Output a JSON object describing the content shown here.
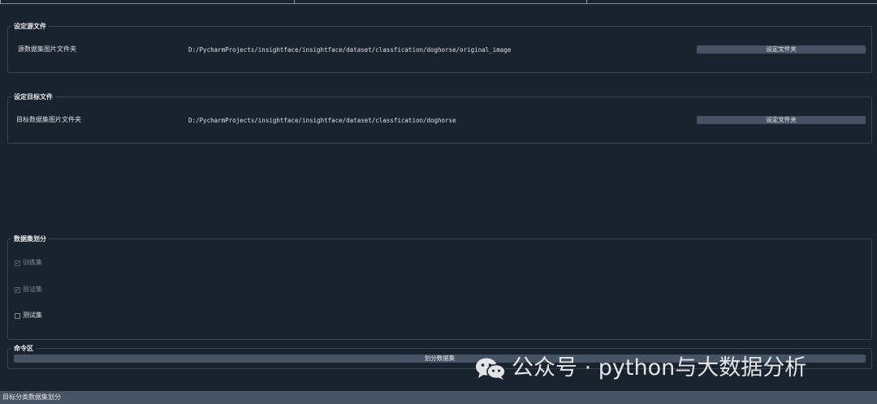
{
  "source_group": {
    "title": "设定源文件",
    "label": "源数据集图片文件夹",
    "path": "D:/PycharmProjects/insightface/insightface/dataset/classfication/doghorse/original_image",
    "button": "设定文件夹"
  },
  "target_group": {
    "title": "设定目标文件",
    "label": "目标数据集图片文件夹",
    "path": "D:/PycharmProjects/insightface/insightface/dataset/classfication/doghorse",
    "button": "设定文件夹"
  },
  "split_group": {
    "title": "数据集划分",
    "options": [
      {
        "label": "训练集",
        "checked": true,
        "enabled": false
      },
      {
        "label": "验证集",
        "checked": true,
        "enabled": false
      },
      {
        "label": "测试集",
        "checked": false,
        "enabled": true
      }
    ]
  },
  "command_group": {
    "title": "命令区",
    "button": "划分数据集"
  },
  "status_bar": {
    "text": "目标分类数据集划分"
  },
  "watermark": {
    "text": "公众号 · python与大数据分析",
    "icon": "wechat-icon"
  },
  "colors": {
    "background": "#19232d",
    "group_border": "#3a4653",
    "button": "#455364",
    "status_bar": "#455364",
    "text": "#dfe1e2"
  }
}
